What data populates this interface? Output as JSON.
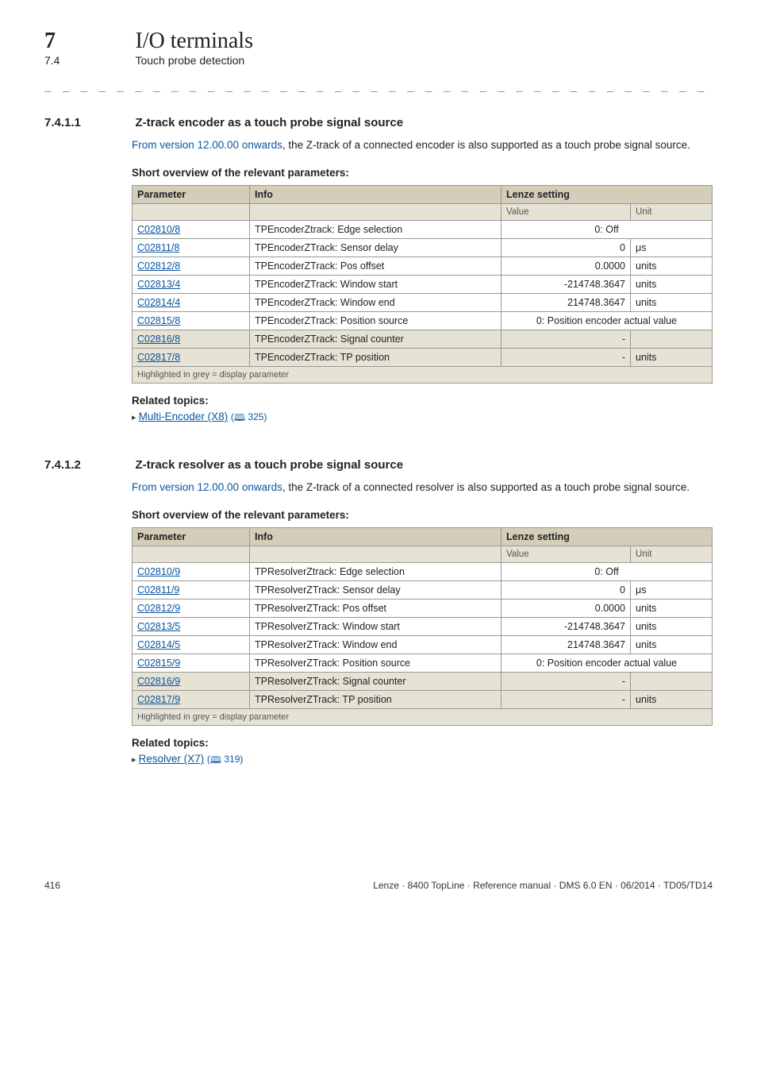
{
  "header": {
    "sec_num": "7",
    "sec_title": "I/O terminals",
    "sub_num": "7.4",
    "sub_title": "Touch probe detection"
  },
  "section1": {
    "num": "7.4.1.1",
    "title": "Z-track encoder as a touch probe signal source",
    "version_note": "From version 12.00.00 onwards",
    "para_rest": ", the Z-track of a connected encoder is also supported as a touch probe signal source.",
    "table_caption": "Short overview of the relevant parameters:",
    "table": {
      "h_param": "Parameter",
      "h_info": "Info",
      "h_setting": "Lenze setting",
      "h_value": "Value",
      "h_unit": "Unit",
      "rows": [
        {
          "p": "C02810/8",
          "i": "TPEncoderZtrack: Edge selection",
          "v": "0: Off",
          "u": "",
          "span": true,
          "grey": false
        },
        {
          "p": "C02811/8",
          "i": "TPEncoderZTrack: Sensor delay",
          "v": "0",
          "u": "μs",
          "span": false,
          "grey": false
        },
        {
          "p": "C02812/8",
          "i": "TPEncoderZTrack: Pos offset",
          "v": "0.0000",
          "u": "units",
          "span": false,
          "grey": false
        },
        {
          "p": "C02813/4",
          "i": "TPEncoderZTrack: Window start",
          "v": "-214748.3647",
          "u": "units",
          "span": false,
          "grey": false
        },
        {
          "p": "C02814/4",
          "i": "TPEncoderZTrack: Window end",
          "v": "214748.3647",
          "u": "units",
          "span": false,
          "grey": false
        },
        {
          "p": "C02815/8",
          "i": "TPEncoderZTrack: Position source",
          "v": "0: Position encoder actual value",
          "u": "",
          "span": true,
          "grey": false
        },
        {
          "p": "C02816/8",
          "i": "TPEncoderZTrack: Signal counter",
          "v": "-",
          "u": "",
          "span": false,
          "grey": true
        },
        {
          "p": "C02817/8",
          "i": "TPEncoderZTrack: TP position",
          "v": "-",
          "u": "units",
          "span": false,
          "grey": true
        }
      ],
      "foot": "Highlighted in grey = display parameter"
    },
    "related_head": "Related topics:",
    "related_link": "Multi-Encoder (X8)",
    "related_page": "325"
  },
  "section2": {
    "num": "7.4.1.2",
    "title": "Z-track resolver as a touch probe signal source",
    "version_note": "From version 12.00.00 onwards",
    "para_rest": ", the Z-track of a connected resolver is also supported as a touch probe signal source.",
    "table_caption": "Short overview of the relevant parameters:",
    "table": {
      "h_param": "Parameter",
      "h_info": "Info",
      "h_setting": "Lenze setting",
      "h_value": "Value",
      "h_unit": "Unit",
      "rows": [
        {
          "p": "C02810/9",
          "i": "TPResolverZtrack: Edge selection",
          "v": "0: Off",
          "u": "",
          "span": true,
          "grey": false
        },
        {
          "p": "C02811/9",
          "i": "TPResolverZTrack: Sensor delay",
          "v": "0",
          "u": "μs",
          "span": false,
          "grey": false
        },
        {
          "p": "C02812/9",
          "i": "TPResolverZTrack: Pos offset",
          "v": "0.0000",
          "u": "units",
          "span": false,
          "grey": false
        },
        {
          "p": "C02813/5",
          "i": "TPResolverZTrack: Window start",
          "v": "-214748.3647",
          "u": "units",
          "span": false,
          "grey": false
        },
        {
          "p": "C02814/5",
          "i": "TPResolverZTrack: Window end",
          "v": "214748.3647",
          "u": "units",
          "span": false,
          "grey": false
        },
        {
          "p": "C02815/9",
          "i": "TPResolverZTrack: Position source",
          "v": "0: Position encoder actual value",
          "u": "",
          "span": true,
          "grey": false
        },
        {
          "p": "C02816/9",
          "i": "TPResolverZTrack: Signal counter",
          "v": "-",
          "u": "",
          "span": false,
          "grey": true
        },
        {
          "p": "C02817/9",
          "i": "TPResolverZTrack: TP position",
          "v": "-",
          "u": "units",
          "span": false,
          "grey": true
        }
      ],
      "foot": "Highlighted in grey = display parameter"
    },
    "related_head": "Related topics:",
    "related_link": "Resolver (X7)",
    "related_page": "319"
  },
  "footer": {
    "page": "416",
    "ref": "Lenze · 8400 TopLine · Reference manual · DMS 6.0 EN · 06/2014 · TD05/TD14"
  }
}
